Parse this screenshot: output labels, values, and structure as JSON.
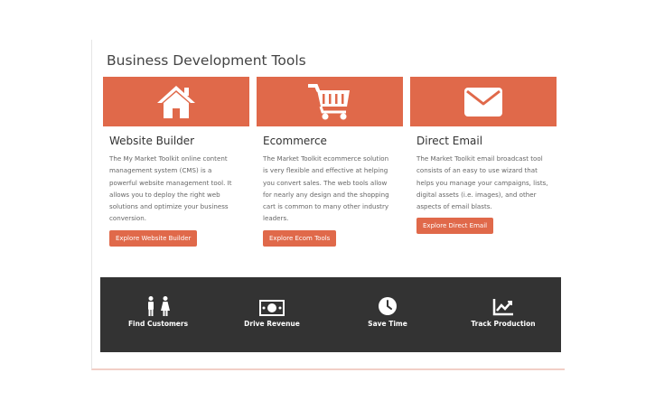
{
  "section": {
    "title": "Business Development Tools"
  },
  "cards": [
    {
      "icon": "house-icon",
      "title": "Website Builder",
      "lines": [
        "The My Market Toolkit online content",
        "management system (CMS) is a",
        "powerful website management tool. It",
        "allows you to deploy the right web",
        "solutions and optimize your business",
        "conversion."
      ],
      "button": "Explore Website Builder"
    },
    {
      "icon": "shopping-cart-icon",
      "title": "Ecommerce",
      "lines": [
        "The Market Toolkit ecommerce solution",
        "is very flexible and effective at helping",
        "you convert sales. The web tools allow",
        "for nearly any design and the shopping",
        "cart is common to many other industry",
        "leaders."
      ],
      "button": "Explore Ecom Tools"
    },
    {
      "icon": "envelope-icon",
      "title": "Direct Email",
      "lines": [
        "The Market Toolkit email broadcast tool",
        "consists of an easy to use wizard that",
        "helps you manage your campaigns, lists,",
        "digital assets (i.e. images), and other",
        "aspects of email blasts."
      ],
      "button": "Explore Direct Email"
    }
  ],
  "stats": [
    {
      "icon": "people-icon",
      "label": "Find Customers"
    },
    {
      "icon": "money-icon",
      "label": "Drive Revenue"
    },
    {
      "icon": "clock-icon",
      "label": "Save Time"
    },
    {
      "icon": "chart-icon",
      "label": "Track Production"
    }
  ],
  "colors": {
    "accent": "#e0694a",
    "dark_band": "#333333"
  }
}
